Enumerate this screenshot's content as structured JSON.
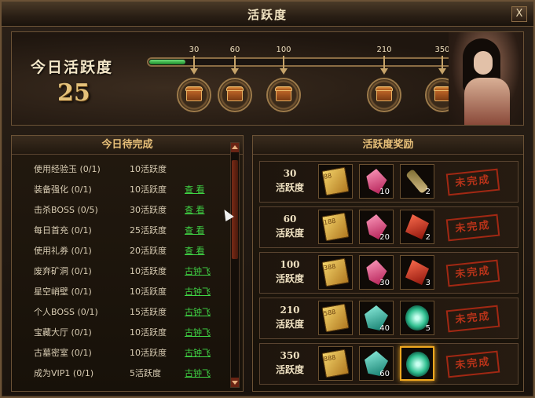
{
  "window": {
    "title": "活跃度",
    "close_label": "X"
  },
  "banner": {
    "today_label": "今日活跃度",
    "today_value": "25",
    "progress": {
      "current": 25,
      "max": 350
    },
    "milestones": [
      {
        "value": "30"
      },
      {
        "value": "60"
      },
      {
        "value": "100"
      },
      {
        "value": "210"
      },
      {
        "value": "350"
      }
    ]
  },
  "tasks": {
    "title": "今日待完成",
    "items": [
      {
        "name": "使用经验玉 (0/1)",
        "points": "10活跃度",
        "link": ""
      },
      {
        "name": "装备强化 (0/1)",
        "points": "10活跃度",
        "link": "查 看"
      },
      {
        "name": "击杀BOSS (0/5)",
        "points": "30活跃度",
        "link": "查 看"
      },
      {
        "name": "每日首充 (0/1)",
        "points": "25活跃度",
        "link": "查 看"
      },
      {
        "name": "使用礼券 (0/1)",
        "points": "20活跃度",
        "link": "查 看"
      },
      {
        "name": "废弃矿洞 (0/1)",
        "points": "10活跃度",
        "link": "古钟飞"
      },
      {
        "name": "星空峭壁 (0/1)",
        "points": "10活跃度",
        "link": "古钟飞"
      },
      {
        "name": "个人BOSS (0/1)",
        "points": "15活跃度",
        "link": "古钟飞"
      },
      {
        "name": "宝藏大厅 (0/1)",
        "points": "10活跃度",
        "link": "古钟飞"
      },
      {
        "name": "古墓密室 (0/1)",
        "points": "10活跃度",
        "link": "古钟飞"
      },
      {
        "name": "成为VIP1 (0/1)",
        "points": "5活跃度",
        "link": "古钟飞"
      }
    ]
  },
  "rewards": {
    "title": "活跃度奖励",
    "level_suffix": "活跃度",
    "status": "未完成",
    "tiers": [
      {
        "level": "30",
        "items": [
          {
            "icon": "gold-ticket-icon",
            "label": "88",
            "count": ""
          },
          {
            "icon": "pink-crystal-icon",
            "label": "",
            "count": "10"
          },
          {
            "icon": "scroll-icon",
            "label": "",
            "count": "2"
          }
        ]
      },
      {
        "level": "60",
        "items": [
          {
            "icon": "gold-ticket-icon",
            "label": "188",
            "count": ""
          },
          {
            "icon": "pink-crystal-icon",
            "label": "",
            "count": "20"
          },
          {
            "icon": "red-gem-icon",
            "label": "",
            "count": "2"
          }
        ]
      },
      {
        "level": "100",
        "items": [
          {
            "icon": "gold-ticket-icon",
            "label": "388",
            "count": ""
          },
          {
            "icon": "pink-crystal-icon",
            "label": "",
            "count": "30"
          },
          {
            "icon": "red-gem-icon",
            "label": "",
            "count": "3"
          }
        ]
      },
      {
        "level": "210",
        "items": [
          {
            "icon": "gold-ticket-icon",
            "label": "588",
            "count": ""
          },
          {
            "icon": "teal-crystal-icon",
            "label": "",
            "count": "40"
          },
          {
            "icon": "green-orb-icon",
            "label": "",
            "count": "5"
          }
        ]
      },
      {
        "level": "350",
        "items": [
          {
            "icon": "gold-ticket-icon",
            "label": "888",
            "count": ""
          },
          {
            "icon": "teal-crystal-icon",
            "label": "",
            "count": "60"
          },
          {
            "icon": "green-orb-icon",
            "label": "",
            "count": ""
          }
        ]
      }
    ]
  }
}
